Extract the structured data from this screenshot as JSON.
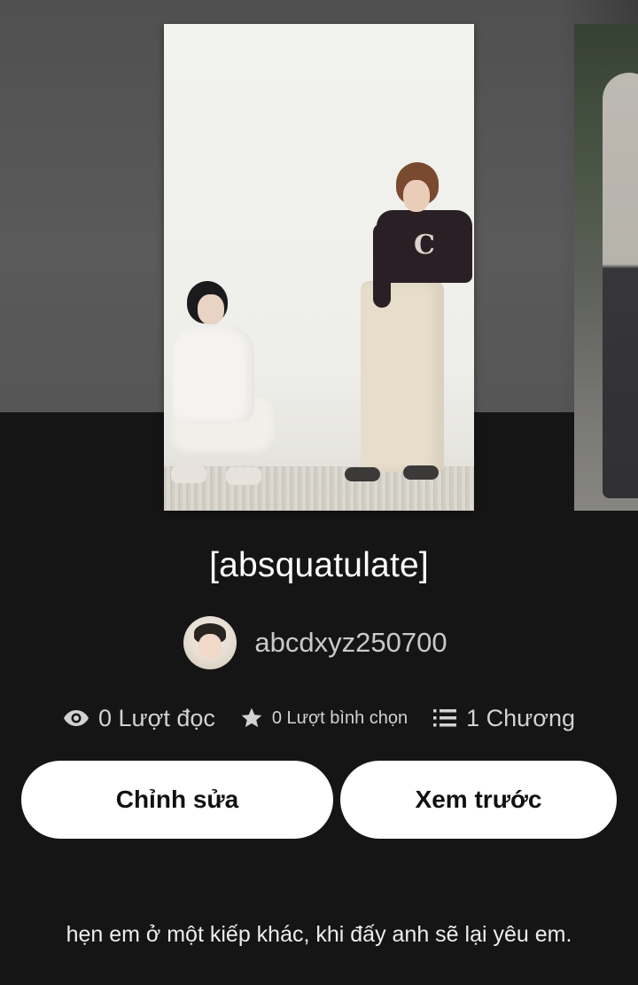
{
  "book": {
    "title": "[absquatulate]",
    "author": "abcdxyz250700",
    "description": "hẹn em ở một kiếp khác, khi đấy anh sẽ lại yêu em.",
    "cover_letter": "C"
  },
  "stats": {
    "reads": "0 Lượt đọc",
    "votes": "0 Lượt bình chọn",
    "chapters": "1 Chương"
  },
  "buttons": {
    "edit": "Chỉnh sửa",
    "preview": "Xem trước"
  },
  "icons": {
    "reads": "eye-icon",
    "votes": "star-icon",
    "chapters": "list-icon"
  },
  "colors": {
    "background": "#151515",
    "hero": "#565656",
    "button": "#ffffff",
    "stat_text": "#d2d2d2"
  }
}
